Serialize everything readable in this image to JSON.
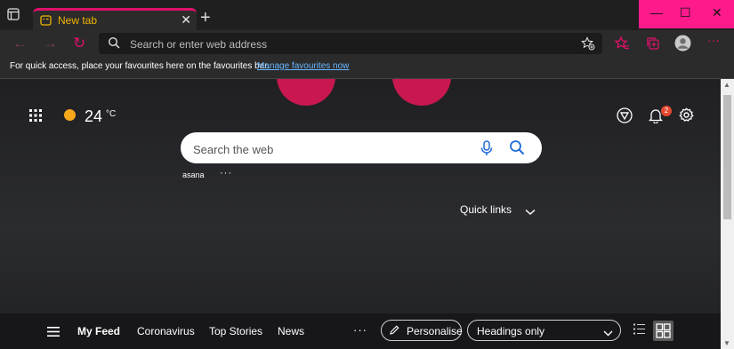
{
  "tab": {
    "title": "New tab",
    "close_glyph": "✕"
  },
  "new_tab_glyph": "+",
  "window_controls": {
    "minimize": "—",
    "maximize": "☐",
    "close": "✕"
  },
  "toolbar": {
    "back_glyph": "←",
    "forward_glyph": "→",
    "refresh_glyph": "↻",
    "address_placeholder": "Search or enter web address",
    "more_glyph": "···"
  },
  "favbar": {
    "message": "For quick access, place your favourites here on the favourites bar.",
    "link": "Manage favourites now"
  },
  "weather": {
    "temp": "24",
    "unit": "°C"
  },
  "notifications": {
    "count": "2"
  },
  "search": {
    "placeholder": "Search the web"
  },
  "suggestion": {
    "label": "asana",
    "more": "···"
  },
  "quick_links": {
    "label": "Quick links"
  },
  "feed": {
    "items": [
      "My Feed",
      "Coronavirus",
      "Top Stories",
      "News"
    ],
    "more": "···",
    "personalise": "Personalise",
    "layout_select": "Headings only"
  },
  "colors": {
    "accent": "#e0106b",
    "window_controls": "#ff1a8c",
    "link": "#6ab7ff",
    "blob": "#c8184f"
  }
}
